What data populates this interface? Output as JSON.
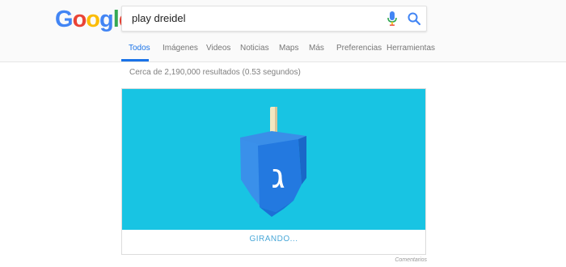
{
  "logo": {
    "letters": [
      "G",
      "o",
      "o",
      "g",
      "l",
      "e"
    ],
    "colors": [
      "#4285F4",
      "#EA4335",
      "#FBBC05",
      "#4285F4",
      "#34A853",
      "#EA4335"
    ]
  },
  "search": {
    "query": "play dreidel"
  },
  "tabs": [
    {
      "label": "Todos",
      "active": true
    },
    {
      "label": "Imágenes",
      "active": false
    },
    {
      "label": "Videos",
      "active": false
    },
    {
      "label": "Noticias",
      "active": false
    },
    {
      "label": "Maps",
      "active": false
    },
    {
      "label": "Más",
      "active": false
    },
    {
      "label": "Preferencias",
      "active": false
    },
    {
      "label": "Herramientas",
      "active": false
    }
  ],
  "results": {
    "count_text": "Cerca de 2,190,000 resultados (0.53 segundos)"
  },
  "game": {
    "background_color": "#18c4e3",
    "dreidel_letter": "ג",
    "status_label": "GIRANDO..."
  },
  "footer": {
    "feedback_label": "Comentarios"
  }
}
